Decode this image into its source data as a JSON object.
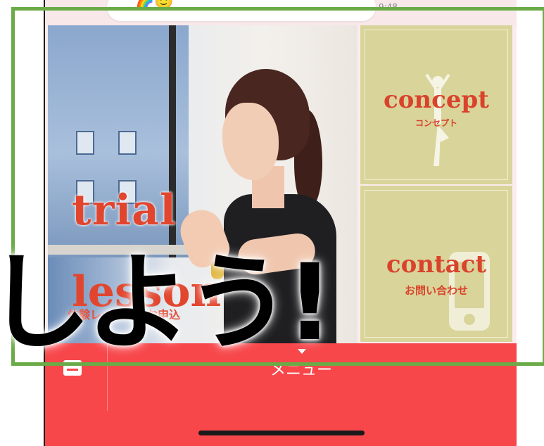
{
  "status_bar": {
    "emoji": "🌈🙂",
    "time": "9:48"
  },
  "hero": {
    "title_line1": "trial",
    "title_line2": "lesson",
    "subtitle": "体験レッスンのお申込"
  },
  "tiles": [
    {
      "title": "concept",
      "subtitle": "コンセプト",
      "icon": "yoga-pose-icon"
    },
    {
      "title": "contact",
      "subtitle": "お問い合わせ",
      "icon": "smartphone-icon"
    }
  ],
  "menu_bar": {
    "label": "メニュー",
    "left_icon": "keyboard-icon",
    "caret_icon": "caret-down-icon"
  },
  "overlay": {
    "caption": "しよう!"
  },
  "colors": {
    "accent_red": "#f7474b",
    "tile_khaki": "#d9d49a",
    "title_red": "#e2452e",
    "highlight_green": "#6aab47"
  }
}
